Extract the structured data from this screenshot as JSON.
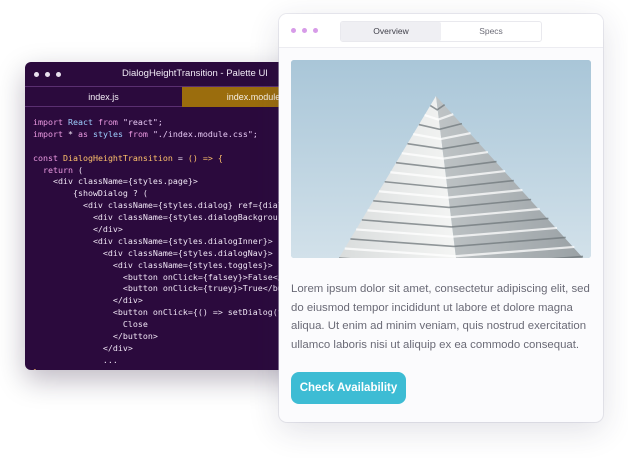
{
  "editor": {
    "title": "DialogHeightTransition - Palette UI",
    "tabs": [
      {
        "label": "index.js",
        "active": true
      },
      {
        "label": "index.module",
        "active": false
      }
    ],
    "code_lines": [
      [
        {
          "t": "kw",
          "v": "import "
        },
        {
          "t": "id",
          "v": "React"
        },
        {
          "t": "kw",
          "v": " from "
        },
        {
          "t": "str",
          "v": "\"react\";"
        }
      ],
      [
        {
          "t": "kw",
          "v": "import "
        },
        {
          "t": "txt",
          "v": "* "
        },
        {
          "t": "kw",
          "v": "as "
        },
        {
          "t": "id",
          "v": "styles"
        },
        {
          "t": "kw",
          "v": " from "
        },
        {
          "t": "str",
          "v": "\"./index.module.css\";"
        }
      ],
      [],
      [
        {
          "t": "kw",
          "v": "const "
        },
        {
          "t": "fn",
          "v": "DialogHeightTransition"
        },
        {
          "t": "txt",
          "v": " = "
        },
        {
          "t": "br",
          "v": "() => {"
        }
      ],
      [
        {
          "t": "txt",
          "v": "  "
        },
        {
          "t": "kw",
          "v": "return "
        },
        {
          "t": "txt",
          "v": "("
        }
      ],
      [
        {
          "t": "txt",
          "v": "    <div className={styles.page}>"
        }
      ],
      [
        {
          "t": "txt",
          "v": "        {showDialog ? ("
        }
      ],
      [
        {
          "t": "txt",
          "v": "          <div className={styles.dialog} ref={dial"
        }
      ],
      [
        {
          "t": "txt",
          "v": "            <div className={styles.dialogBackgrou"
        }
      ],
      [
        {
          "t": "txt",
          "v": "            </div>"
        }
      ],
      [
        {
          "t": "txt",
          "v": "            <div className={styles.dialogInner}>"
        }
      ],
      [
        {
          "t": "txt",
          "v": "              <div className={styles.dialogNav}>"
        }
      ],
      [
        {
          "t": "txt",
          "v": "                <div className={styles.toggles}>"
        }
      ],
      [
        {
          "t": "txt",
          "v": "                  <button onClick={falsey}>False</"
        }
      ],
      [
        {
          "t": "txt",
          "v": "                  <button onClick={truey}>True</bu"
        }
      ],
      [
        {
          "t": "txt",
          "v": "                </div>"
        }
      ],
      [
        {
          "t": "txt",
          "v": "                <button onClick={() => setDialog(f"
        }
      ],
      [
        {
          "t": "txt",
          "v": "                  Close"
        }
      ],
      [
        {
          "t": "txt",
          "v": "                </button>"
        }
      ],
      [
        {
          "t": "txt",
          "v": "              </div>"
        }
      ],
      [
        {
          "t": "txt",
          "v": "              ..."
        }
      ],
      [
        {
          "t": "br",
          "v": "}"
        }
      ]
    ]
  },
  "preview": {
    "tabs": [
      {
        "label": "Overview",
        "active": true
      },
      {
        "label": "Specs",
        "active": false
      }
    ],
    "image_subject": "building-image",
    "description": "Lorem ipsum dolor sit amet, consectetur adipiscing elit, sed do eiusmod tempor incididunt ut labore et dolore magna aliqua. Ut enim ad minim veniam, quis nostrud exercitation ullamco laboris nisi ut aliquip ex ea commodo consequat.",
    "cta_label": "Check Availability"
  },
  "colors": {
    "editor_bg": "#2b0a3d",
    "tab_inactive": "#9b6d0d",
    "accent_cta": "#3dbcd4",
    "window_dots_preview": "#d79be8"
  }
}
